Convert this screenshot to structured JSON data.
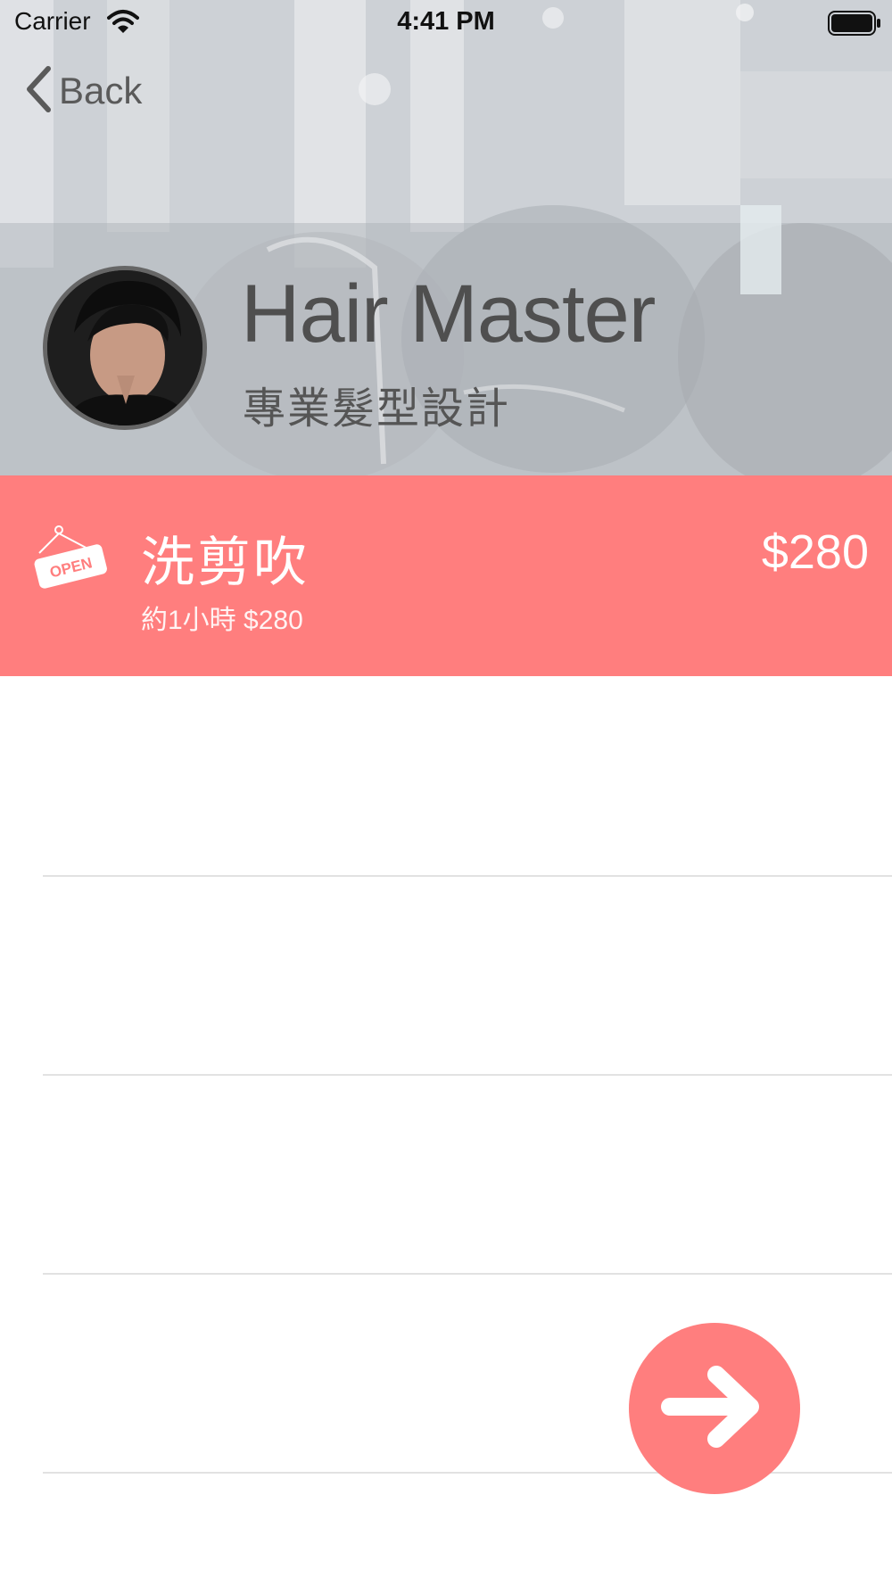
{
  "statusbar": {
    "carrier": "Carrier",
    "time": "4:41 PM"
  },
  "nav": {
    "back_label": "Back"
  },
  "profile": {
    "name": "Hair Master",
    "tagline": "專業髮型設計"
  },
  "service": {
    "name": "洗剪吹",
    "detail": "約1小時 $280",
    "price": "$280",
    "status_icon": "open-sign-icon",
    "status_icon_text": "OPEN"
  },
  "list": {
    "rows": [
      "",
      "",
      "",
      ""
    ]
  },
  "fab": {
    "icon": "arrow-right-icon"
  },
  "colors": {
    "accent": "#ff7e7e",
    "text_dark": "#4f4f4f",
    "divider": "#e2e2e2"
  }
}
